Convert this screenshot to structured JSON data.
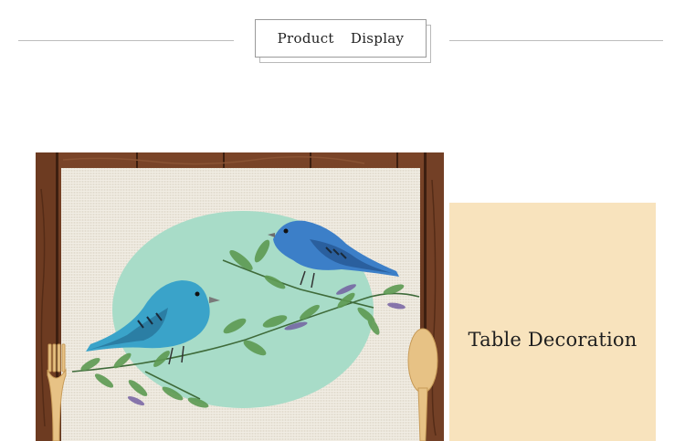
{
  "header": {
    "title": "Product  Display"
  },
  "product_image": {
    "icons": [
      "wood-board-background",
      "linen-placemat",
      "mint-circle",
      "blue-bird",
      "leaf-branch",
      "wooden-fork-icon",
      "wooden-spoon-icon"
    ]
  },
  "decoration_panel": {
    "label": "Table Decoration",
    "background": "#f8e3bd"
  },
  "colors": {
    "wood": "#6b3a22",
    "linen": "#ece7dc",
    "mint": "#a6dcc6",
    "bird_blue": "#3c86c8",
    "leaf_green": "#5d9a52"
  }
}
